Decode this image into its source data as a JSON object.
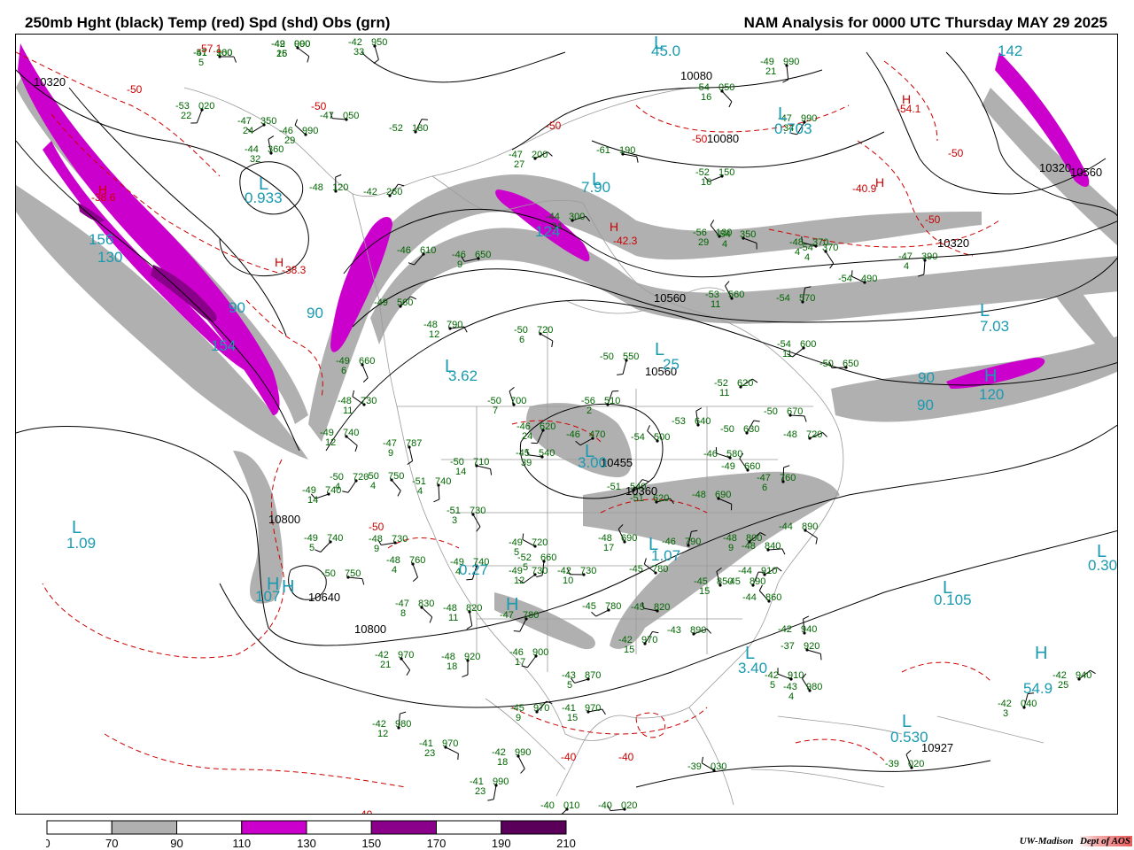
{
  "header": {
    "left_title": "250mb Hght (black) Temp (red) Spd (shd) Obs (grn)",
    "right_title": "NAM Analysis for 0000 UTC Thursday  MAY 29 2025"
  },
  "colors": {
    "height_contour": "#000000",
    "temperature_contour": "#cc0000",
    "observations": "#006600",
    "speed_extrema": "#1a9ab0",
    "geography": "#9a9a9a",
    "speed_shading": [
      "#ffffff",
      "#b0b0b0",
      "#ffffff",
      "#cc00cc",
      "#ffffff",
      "#8a008a",
      "#ffffff",
      "#5a005a"
    ]
  },
  "colorbar": {
    "ticks": [
      "0",
      "70",
      "90",
      "110",
      "130",
      "150",
      "170",
      "190",
      "210"
    ]
  },
  "credit": {
    "org": "UW-Madison",
    "dept": "Dept of AOS"
  },
  "height_labels": [
    "10320",
    "10080",
    "10080",
    "10320",
    "10560",
    "10320",
    "10560",
    "10560",
    "10800",
    "10800",
    "10640",
    "10455",
    "10560",
    "10927",
    "10360"
  ],
  "temperature_labels": [
    "-57.1",
    "-50",
    "-50",
    "-50",
    "-50",
    "-54.1",
    "-50",
    "-40.9",
    "-38.6",
    "-38.3",
    "-42.3",
    "-50",
    "-40",
    "-40",
    "-40",
    "-50"
  ],
  "extrema_H": [
    "H",
    "H",
    "H",
    "H",
    "H",
    "H",
    "H",
    "H",
    "H",
    "H"
  ],
  "extrema_L": [
    "L",
    "L",
    "L",
    "L",
    "L",
    "L",
    "L",
    "L",
    "L",
    "L",
    "L",
    "L",
    "L",
    "L"
  ],
  "speed_values": [
    "45.0",
    "142",
    "0.703",
    "7.90",
    "124",
    "0.933",
    "156",
    "130",
    "90",
    "90",
    "154",
    "3.62",
    "25",
    "7.03",
    "90",
    "120",
    "90",
    "1.09",
    "3.00",
    "107",
    "1.07",
    "0.27",
    "0.105",
    "0.30",
    "3.40",
    "54.9",
    "0.530"
  ],
  "observations": [
    {
      "t": "-57",
      "h": "100"
    },
    {
      "t": "-49",
      "h": "000",
      "s": "25"
    },
    {
      "t": "-42",
      "h": "950",
      "s": "33"
    },
    {
      "t": "-53",
      "h": "020",
      "s": "22"
    },
    {
      "t": "-47",
      "h": "350",
      "s": "24"
    },
    {
      "t": "-47",
      "h": "050"
    },
    {
      "t": "-46",
      "h": "990",
      "s": "29"
    },
    {
      "t": "-44",
      "h": "360",
      "s": "32"
    },
    {
      "t": "-52",
      "h": "180"
    },
    {
      "t": "-47",
      "h": "200",
      "s": "27"
    },
    {
      "t": "-61",
      "h": "190"
    },
    {
      "t": "-54",
      "h": "050",
      "s": "16"
    },
    {
      "t": "-49",
      "h": "990",
      "s": "21"
    },
    {
      "t": "-47",
      "h": "990",
      "s": "34"
    },
    {
      "t": "-52",
      "h": "150",
      "s": "16"
    },
    {
      "t": "-48",
      "h": "370",
      "s": "4"
    },
    {
      "t": "-56",
      "h": "130",
      "s": "29"
    },
    {
      "t": "-48",
      "h": "120"
    },
    {
      "t": "-42",
      "h": "260"
    },
    {
      "t": "-44",
      "h": "300",
      "s": "34"
    },
    {
      "t": "-54",
      "h": "350",
      "s": "4"
    },
    {
      "t": "-54",
      "h": "370",
      "s": "4"
    },
    {
      "t": "-47",
      "h": "390",
      "s": "4"
    },
    {
      "t": "-46",
      "h": "610"
    },
    {
      "t": "-46",
      "h": "650",
      "s": "9"
    },
    {
      "t": "-54",
      "h": "490"
    },
    {
      "t": "-53",
      "h": "560",
      "s": "11"
    },
    {
      "t": "-54",
      "h": "570"
    },
    {
      "t": "-49",
      "h": "560"
    },
    {
      "t": "-48",
      "h": "790",
      "s": "12"
    },
    {
      "t": "-50",
      "h": "720",
      "s": "6"
    },
    {
      "t": "-49",
      "h": "660",
      "s": "6"
    },
    {
      "t": "-50",
      "h": "550"
    },
    {
      "t": "-54",
      "h": "600",
      "s": "11"
    },
    {
      "t": "-50",
      "h": "650"
    },
    {
      "t": "-48",
      "h": "730",
      "s": "11"
    },
    {
      "t": "-50",
      "h": "700",
      "s": "7"
    },
    {
      "t": "-56",
      "h": "510",
      "s": "2"
    },
    {
      "t": "-52",
      "h": "620",
      "s": "11"
    },
    {
      "t": "-50",
      "h": "670"
    },
    {
      "t": "-49",
      "h": "740",
      "s": "12"
    },
    {
      "t": "-47",
      "h": "787",
      "s": "9"
    },
    {
      "t": "-46",
      "h": "620",
      "s": "24"
    },
    {
      "t": "-46",
      "h": "470"
    },
    {
      "t": "-45",
      "h": "540",
      "s": "39"
    },
    {
      "t": "-54",
      "h": "500"
    },
    {
      "t": "-53",
      "h": "640"
    },
    {
      "t": "-50",
      "h": "630"
    },
    {
      "t": "-48",
      "h": "720"
    },
    {
      "t": "-50",
      "h": "710",
      "s": "14"
    },
    {
      "t": "-50",
      "h": "750",
      "s": "4"
    },
    {
      "t": "-51",
      "h": "740",
      "s": "4"
    },
    {
      "t": "-50",
      "h": "720",
      "s": "4"
    },
    {
      "t": "-49",
      "h": "740",
      "s": "14"
    },
    {
      "t": "-46",
      "h": "580"
    },
    {
      "t": "-49",
      "h": "660"
    },
    {
      "t": "-47",
      "h": "760",
      "s": "6"
    },
    {
      "t": "-51",
      "h": "540"
    },
    {
      "t": "-51",
      "h": "620"
    },
    {
      "t": "-48",
      "h": "690"
    },
    {
      "t": "-51",
      "h": "730",
      "s": "3"
    },
    {
      "t": "-52",
      "h": "660",
      "s": "5"
    },
    {
      "t": "-49",
      "h": "740",
      "s": "5"
    },
    {
      "t": "-48",
      "h": "730",
      "s": "9"
    },
    {
      "t": "-49",
      "h": "720",
      "s": "5"
    },
    {
      "t": "-48",
      "h": "690",
      "s": "17"
    },
    {
      "t": "-46",
      "h": "790"
    },
    {
      "t": "-48",
      "h": "800",
      "s": "9"
    },
    {
      "t": "-48",
      "h": "840"
    },
    {
      "t": "-44",
      "h": "890"
    },
    {
      "t": "-48",
      "h": "760",
      "s": "4"
    },
    {
      "t": "-49",
      "h": "740",
      "s": "4"
    },
    {
      "t": "-49",
      "h": "730",
      "s": "12"
    },
    {
      "t": "-42",
      "h": "730",
      "s": "10"
    },
    {
      "t": "-45",
      "h": "780"
    },
    {
      "t": "-45",
      "h": "850",
      "s": "15"
    },
    {
      "t": "-45",
      "h": "890"
    },
    {
      "t": "-44",
      "h": "910"
    },
    {
      "t": "-50",
      "h": "750"
    },
    {
      "t": "-47",
      "h": "830",
      "s": "8"
    },
    {
      "t": "-48",
      "h": "820",
      "s": "11"
    },
    {
      "t": "-47",
      "h": "780"
    },
    {
      "t": "-45",
      "h": "780"
    },
    {
      "t": "-45",
      "h": "820"
    },
    {
      "t": "-44",
      "h": "860"
    },
    {
      "t": "-42",
      "h": "940"
    },
    {
      "t": "-42",
      "h": "970",
      "s": "15"
    },
    {
      "t": "-43",
      "h": "890"
    },
    {
      "t": "-37",
      "h": "920"
    },
    {
      "t": "-42",
      "h": "970",
      "s": "21"
    },
    {
      "t": "-48",
      "h": "920",
      "s": "18"
    },
    {
      "t": "-46",
      "h": "900",
      "s": "17"
    },
    {
      "t": "-43",
      "h": "870",
      "s": "5"
    },
    {
      "t": "-42",
      "h": "910",
      "s": "5"
    },
    {
      "t": "-43",
      "h": "980",
      "s": "4"
    },
    {
      "t": "-42",
      "h": "980",
      "s": "12"
    },
    {
      "t": "-45",
      "h": "970",
      "s": "9"
    },
    {
      "t": "-41",
      "h": "970",
      "s": "15"
    },
    {
      "t": "-41",
      "h": "970",
      "s": "23"
    },
    {
      "t": "-42",
      "h": "990",
      "s": "18"
    },
    {
      "t": "-41",
      "h": "990",
      "s": "23"
    },
    {
      "t": "-40",
      "h": "010"
    },
    {
      "t": "-40",
      "h": "020"
    },
    {
      "t": "-39",
      "h": "030"
    },
    {
      "t": "-39",
      "h": "020"
    },
    {
      "t": "-42",
      "h": "040",
      "s": "3"
    },
    {
      "t": "-42",
      "h": "940",
      "s": "25"
    },
    {
      "t": "-41",
      "h": "960",
      "s": "5"
    },
    {
      "t": "-42",
      "h": "990",
      "s": "16"
    }
  ]
}
